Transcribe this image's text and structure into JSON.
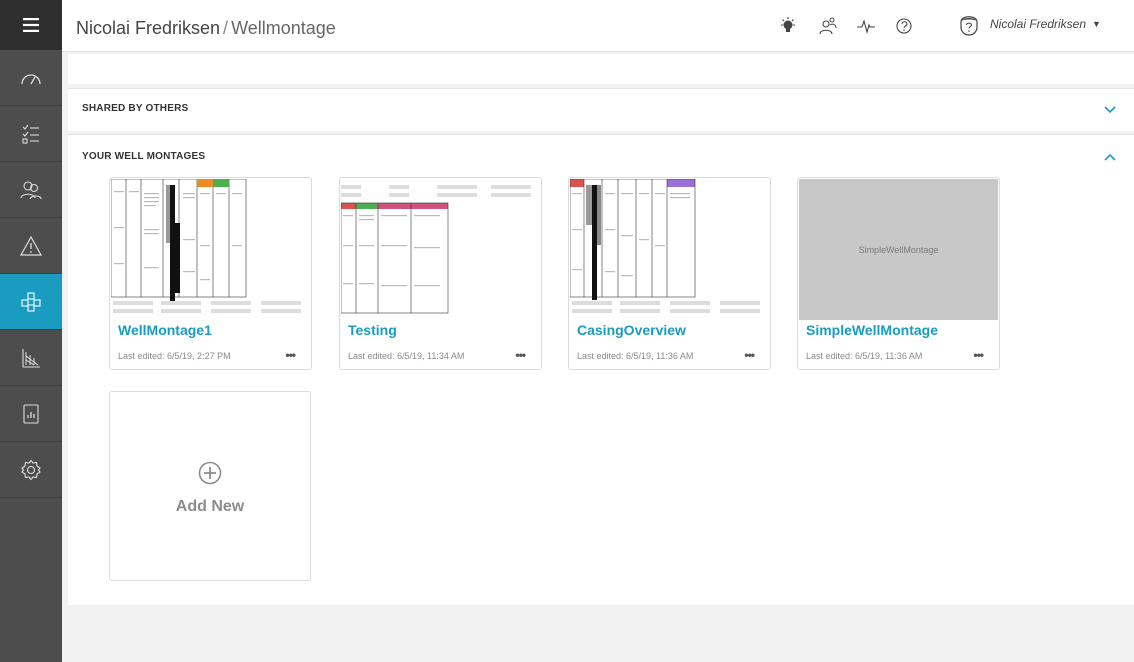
{
  "header": {
    "owner": "Nicolai Fredriksen",
    "separator": "/",
    "page": "Wellmontage",
    "user_name": "Nicolai Fredriksen",
    "icons": [
      "lightbulb-icon",
      "users-icon",
      "activity-icon",
      "help-icon"
    ]
  },
  "sidebar": {
    "items": [
      {
        "icon": "menu-icon"
      },
      {
        "icon": "dashboard-gauge-icon"
      },
      {
        "icon": "checklist-icon"
      },
      {
        "icon": "users-icon"
      },
      {
        "icon": "warning-icon"
      },
      {
        "icon": "well-montage-icon",
        "active": true
      },
      {
        "icon": "chart-grid-icon"
      },
      {
        "icon": "report-icon"
      },
      {
        "icon": "settings-icon"
      }
    ]
  },
  "shared": {
    "title": "SHARED BY OTHERS"
  },
  "yours": {
    "title": "YOUR WELL MONTAGES"
  },
  "montages": [
    {
      "title": "WellMontage1",
      "date": "Last edited: 6/5/19, 2:27 PM",
      "more": "•••"
    },
    {
      "title": "Testing",
      "date": "Last edited: 6/5/19, 11:34 AM",
      "more": "•••"
    },
    {
      "title": "CasingOverview",
      "date": "Last edited: 6/5/19, 11:36 AM",
      "more": "•••"
    },
    {
      "title": "SimpleWellMontage",
      "date": "Last edited: 6/5/19, 11:36 AM",
      "more": "•••",
      "placeholder": "SimpleWellMontage"
    }
  ],
  "add_new": {
    "label": "Add New"
  },
  "colors": {
    "accent": "#1a9bc0",
    "sidebar": "#4d4d4d"
  }
}
